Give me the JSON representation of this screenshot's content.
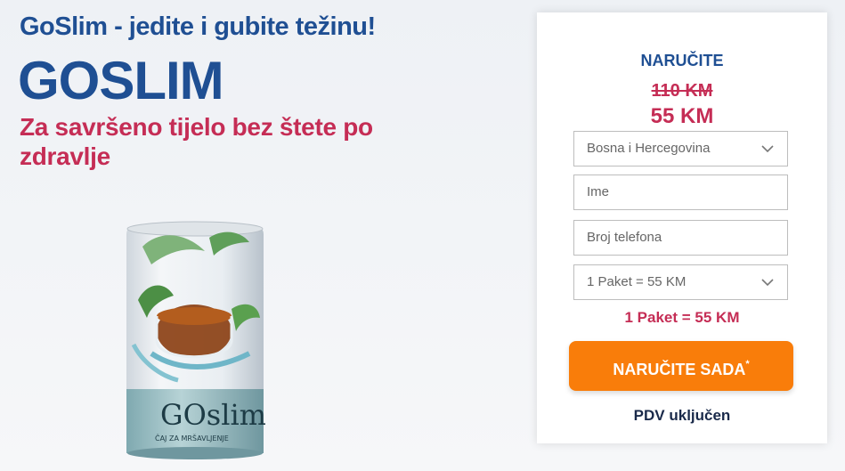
{
  "hero": {
    "tagline": "GoSlim - jedite i gubite težinu!",
    "brand": "GOSLIM",
    "subtitle": "Za savršeno tijelo bez štete po zdravlje"
  },
  "product": {
    "label_brand": "GOslim",
    "label_caption": "ČAJ ZA MRŠAVLJENJE"
  },
  "order": {
    "title": "NARUČITE",
    "old_price": "110 KM",
    "new_price": "55 KM",
    "country_value": "Bosna i Hercegovina",
    "name_placeholder": "Ime",
    "phone_placeholder": "Broj telefona",
    "package_value": "1 Paket = 55 KM",
    "package_summary": "1 Paket = 55 KM",
    "button_label": "NARUČITE SADA",
    "button_mark": "*",
    "vat_note": "PDV uključen"
  },
  "colors": {
    "brand_blue": "#1f4f93",
    "accent_red": "#c52d55",
    "button_orange": "#f97d0a"
  }
}
